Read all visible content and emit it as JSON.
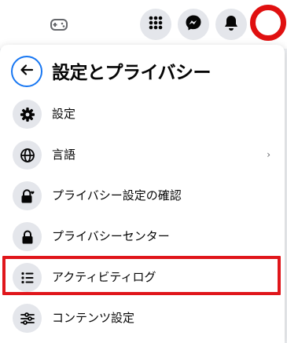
{
  "header": {
    "gaming_icon": "gamepad-icon",
    "menu_icon": "grid-menu-icon",
    "messenger_icon": "messenger-icon",
    "notifications_icon": "bell-icon",
    "avatar_color": "#e01010"
  },
  "panel": {
    "title": "設定とプライバシー",
    "back_icon": "arrow-left-icon",
    "items": [
      {
        "label": "設定",
        "icon": "gear-icon"
      },
      {
        "label": "言語",
        "icon": "globe-icon",
        "chevron": "›"
      },
      {
        "label": "プライバシー設定の確認",
        "icon": "lock-heart-icon"
      },
      {
        "label": "プライバシーセンター",
        "icon": "lock-icon"
      },
      {
        "label": "アクティビティログ",
        "icon": "list-icon",
        "highlighted": true
      },
      {
        "label": "コンテンツ設定",
        "icon": "sliders-icon"
      }
    ]
  },
  "colors": {
    "accent": "#1877f2",
    "highlight_border": "#e0161b",
    "icon_bg": "#e4e6eb"
  }
}
